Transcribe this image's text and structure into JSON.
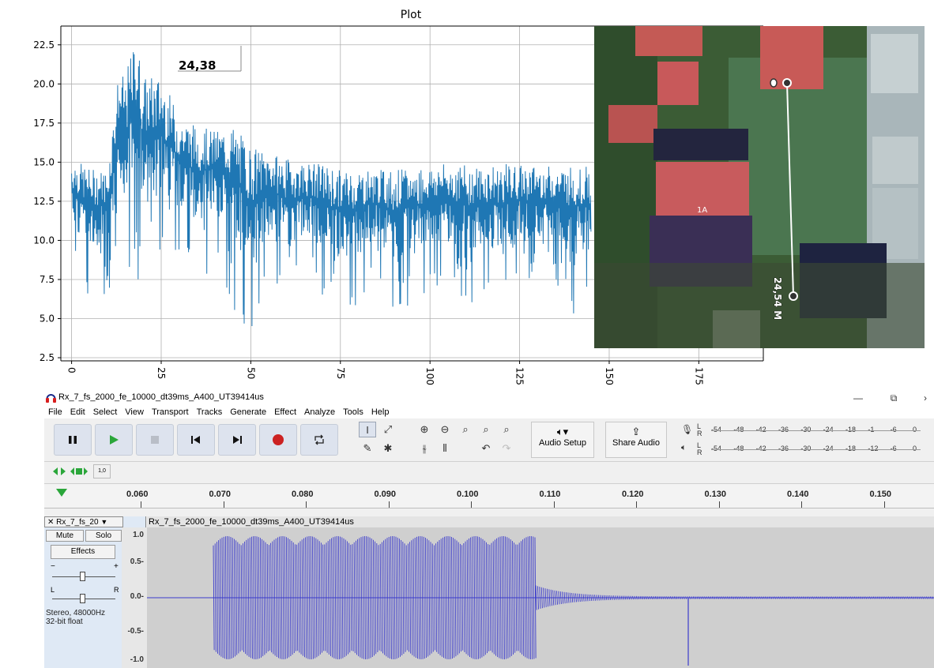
{
  "plot": {
    "title": "Plot",
    "peak_annotation": "24,38",
    "y_ticks": [
      "2.5",
      "5.0",
      "7.5",
      "10.0",
      "12.5",
      "15.0",
      "17.5",
      "20.0",
      "22.5"
    ],
    "x_ticks": [
      "0",
      "25",
      "50",
      "75",
      "100",
      "125",
      "150",
      "175"
    ]
  },
  "chart_data": {
    "type": "line",
    "title": "Plot",
    "xlabel": "",
    "ylabel": "",
    "xlim": [
      -3,
      193
    ],
    "ylim": [
      2.3,
      23.7
    ],
    "grid": true,
    "x_ticks": [
      0,
      25,
      50,
      75,
      100,
      125,
      150,
      175
    ],
    "y_ticks": [
      2.5,
      5.0,
      7.5,
      10.0,
      12.5,
      15.0,
      17.5,
      20.0,
      22.5
    ],
    "series": [
      {
        "color": "#1f77b4",
        "x": [
          0,
          5,
          10,
          13,
          15,
          18,
          20,
          25,
          30,
          35,
          40,
          45,
          50,
          55,
          60,
          65,
          70,
          75,
          80,
          85,
          90,
          95,
          100,
          105,
          110,
          115,
          120,
          125,
          130,
          135,
          140,
          145
        ],
        "y": [
          15.3,
          14.6,
          14.5,
          20.5,
          20.5,
          23.1,
          20.5,
          20.5,
          18.0,
          17.3,
          17.0,
          17.4,
          16.0,
          15.6,
          15.2,
          15.0,
          14.9,
          14.5,
          14.6,
          14.5,
          14.6,
          14.5,
          14.8,
          14.9,
          14.8,
          14.7,
          14.9,
          14.8,
          14.8,
          14.7,
          14.8,
          14.7
        ],
        "y_low": [
          8.1,
          6.2,
          6.5,
          9.8,
          7.0,
          7.2,
          6.8,
          7.5,
          8.0,
          7.0,
          8.5,
          5.0,
          3.4,
          7.4,
          6.0,
          7.3,
          6.4,
          4.9,
          5.5,
          7.2,
          4.7,
          6.1,
          6.6,
          6.9,
          5.6,
          6.3,
          5.8,
          6.6,
          7.2,
          6.9,
          5.3,
          6.4
        ]
      }
    ]
  },
  "map": {
    "building_label": "1A",
    "measurement": "24,54 M"
  },
  "audacity": {
    "window_title": "Rx_7_fs_2000_fe_10000_dt39ms_A400_UT39414us",
    "window_controls": [
      "—",
      "⧉",
      "›"
    ],
    "menu": [
      "File",
      "Edit",
      "Select",
      "View",
      "Transport",
      "Tracks",
      "Generate",
      "Effect",
      "Analyze",
      "Tools",
      "Help"
    ],
    "audio_setup": "Audio Setup",
    "share_audio": "Share Audio",
    "meter_scale": [
      "-54",
      "-48",
      "-42",
      "-36",
      "-30",
      "-24",
      "-18",
      "-12",
      "-6",
      "0"
    ],
    "meter_rec_scale": [
      "-54",
      "-48",
      "-42",
      "-36",
      "-30",
      "-24",
      "-18",
      "-1",
      "-6",
      "0"
    ],
    "meter_lr": [
      "L",
      "R"
    ],
    "ruler_ticks": [
      "0.060",
      "0.070",
      "0.080",
      "0.090",
      "0.100",
      "0.110",
      "0.120",
      "0.130",
      "0.140",
      "0.150"
    ],
    "track": {
      "name_short": "Rx_7_fs_20",
      "name_full": "Rx_7_fs_2000_fe_10000_dt39ms_A400_UT39414us",
      "mute": "Mute",
      "solo": "Solo",
      "effects": "Effects",
      "gain_minus": "−",
      "gain_plus": "+",
      "pan_left": "L",
      "pan_right": "R",
      "info_rate": "Stereo, 48000Hz",
      "info_format": "32-bit float",
      "scale": [
        "1.0",
        "0.5-",
        "0.0-",
        "-0.5-",
        "-1.0"
      ]
    },
    "colors": {
      "waveform": "#3b3bcc",
      "play": "#2aa63a",
      "record": "#cc2222"
    }
  }
}
